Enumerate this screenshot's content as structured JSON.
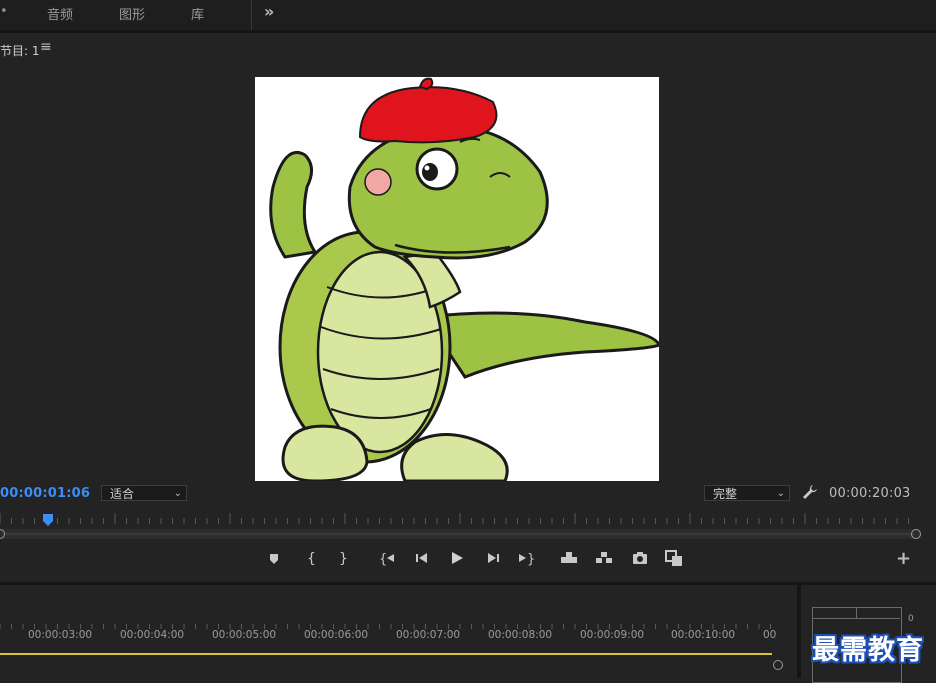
{
  "workspace_tabs": {
    "partial_left": "•",
    "items": [
      {
        "label": "音频"
      },
      {
        "label": "图形"
      },
      {
        "label": "库"
      }
    ]
  },
  "program_monitor": {
    "title": "节目: 1",
    "menu_icon": "hamburger-icon",
    "current_timecode": "00:00:01:06",
    "zoom_level": "适合",
    "playback_quality": "完整",
    "duration_timecode": "00:00:20:03",
    "playhead_position_fraction": 0.052
  },
  "transport_controls": [
    {
      "name": "add-marker-button",
      "icon": "marker-icon"
    },
    {
      "name": "mark-in-button",
      "icon": "mark-in-icon"
    },
    {
      "name": "mark-out-button",
      "icon": "mark-out-icon"
    },
    {
      "name": "go-to-in-button",
      "icon": "go-to-in-icon"
    },
    {
      "name": "step-back-button",
      "icon": "step-back-icon"
    },
    {
      "name": "play-button",
      "icon": "play-icon"
    },
    {
      "name": "step-forward-button",
      "icon": "step-forward-icon"
    },
    {
      "name": "go-to-out-button",
      "icon": "go-to-out-icon"
    },
    {
      "name": "lift-button",
      "icon": "lift-icon"
    },
    {
      "name": "extract-button",
      "icon": "extract-icon"
    },
    {
      "name": "export-frame-button",
      "icon": "camera-icon"
    },
    {
      "name": "compare-view-button",
      "icon": "compare-icon"
    }
  ],
  "timeline": {
    "ruler_labels": [
      "00:00:03:00",
      "00:00:04:00",
      "00:00:05:00",
      "00:00:06:00",
      "00:00:07:00",
      "00:00:08:00",
      "00:00:09:00",
      "00:00:10:00",
      "00"
    ]
  },
  "audio_meters": {
    "scale_top": "0"
  },
  "watermark": "最需教育",
  "colors": {
    "accent_timecode": "#3b8ef5",
    "work_area": "#d9c43a",
    "panel_bg": "#232323",
    "dino_green": "#9dc244",
    "hat_red": "#e0141c"
  }
}
